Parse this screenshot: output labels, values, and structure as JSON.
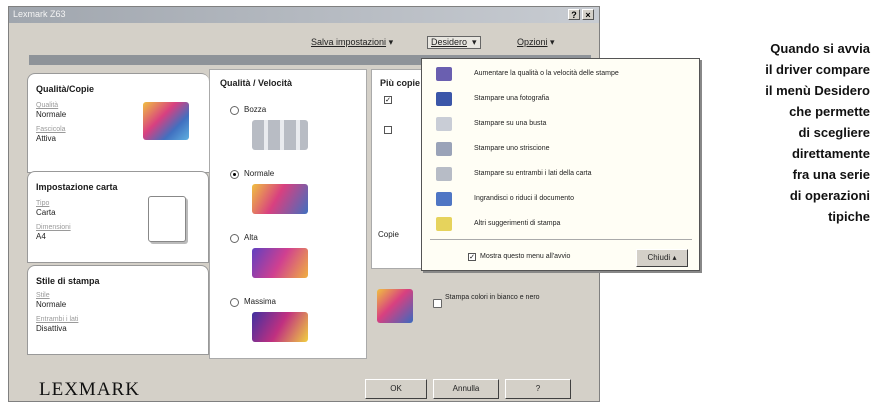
{
  "window": {
    "title": "Lexmark Z63",
    "help_glyph": "?",
    "close_glyph": "×"
  },
  "menubar": {
    "save_settings": "Salva impostazioni",
    "desidero": "Desidero",
    "options": "Opzioni",
    "arrow": "▾"
  },
  "tabs": {
    "quality": {
      "title": "Qualità/Copie",
      "f1_label": "Qualità",
      "f1_value": "Normale",
      "f2_label": "Fascicola",
      "f2_value": "Attiva"
    },
    "paper": {
      "title": "Impostazione carta",
      "f1_label": "Tipo",
      "f1_value": "Carta",
      "f2_label": "Dimensioni",
      "f2_value": "A4"
    },
    "style": {
      "title": "Stile di stampa",
      "f1_label": "Stile",
      "f1_value": "Normale",
      "f2_label": "Entrambi i lati",
      "f2_value": "Disattiva"
    }
  },
  "quality_panel": {
    "heading": "Qualità / Velocità",
    "options": [
      "Bozza",
      "Normale",
      "Alta",
      "Massima"
    ],
    "selected": "Normale"
  },
  "copies_panel": {
    "heading": "Più copie",
    "copies_label": "Copie"
  },
  "bw_option": {
    "label": "Stampa colori in bianco e nero"
  },
  "footer": {
    "logo": "LEXMARK",
    "ok": "OK",
    "cancel": "Annulla",
    "help": "?"
  },
  "dropdown": {
    "items": [
      {
        "label": "Aumentare la qualità o la velocità delle stampe",
        "icon": "quality-speed-icon",
        "color": "#6a5fb0"
      },
      {
        "label": "Stampare una fotografia",
        "icon": "photo-icon",
        "color": "#3b56a8"
      },
      {
        "label": "Stampare su una busta",
        "icon": "envelope-icon",
        "color": "#c9cdd6"
      },
      {
        "label": "Stampare uno striscione",
        "icon": "banner-icon",
        "color": "#9aa3b8"
      },
      {
        "label": "Stampare su entrambi i lati della carta",
        "icon": "duplex-icon",
        "color": "#b7bcc6"
      },
      {
        "label": "Ingrandisci o riduci il documento",
        "icon": "resize-icon",
        "color": "#4f76c4"
      },
      {
        "label": "Altri suggerimenti di stampa",
        "icon": "tips-icon",
        "color": "#e6d35c"
      }
    ],
    "show_on_start": "Mostra questo menu all'avvio",
    "show_on_start_checked": true,
    "close": "Chiudi"
  },
  "caption": {
    "text": "Quando si avvia\nil driver compare\nil menù Desidero\nche permette\ndi scegliere\ndirettamente\nfra una serie\ndi operazioni\ntipiche"
  }
}
